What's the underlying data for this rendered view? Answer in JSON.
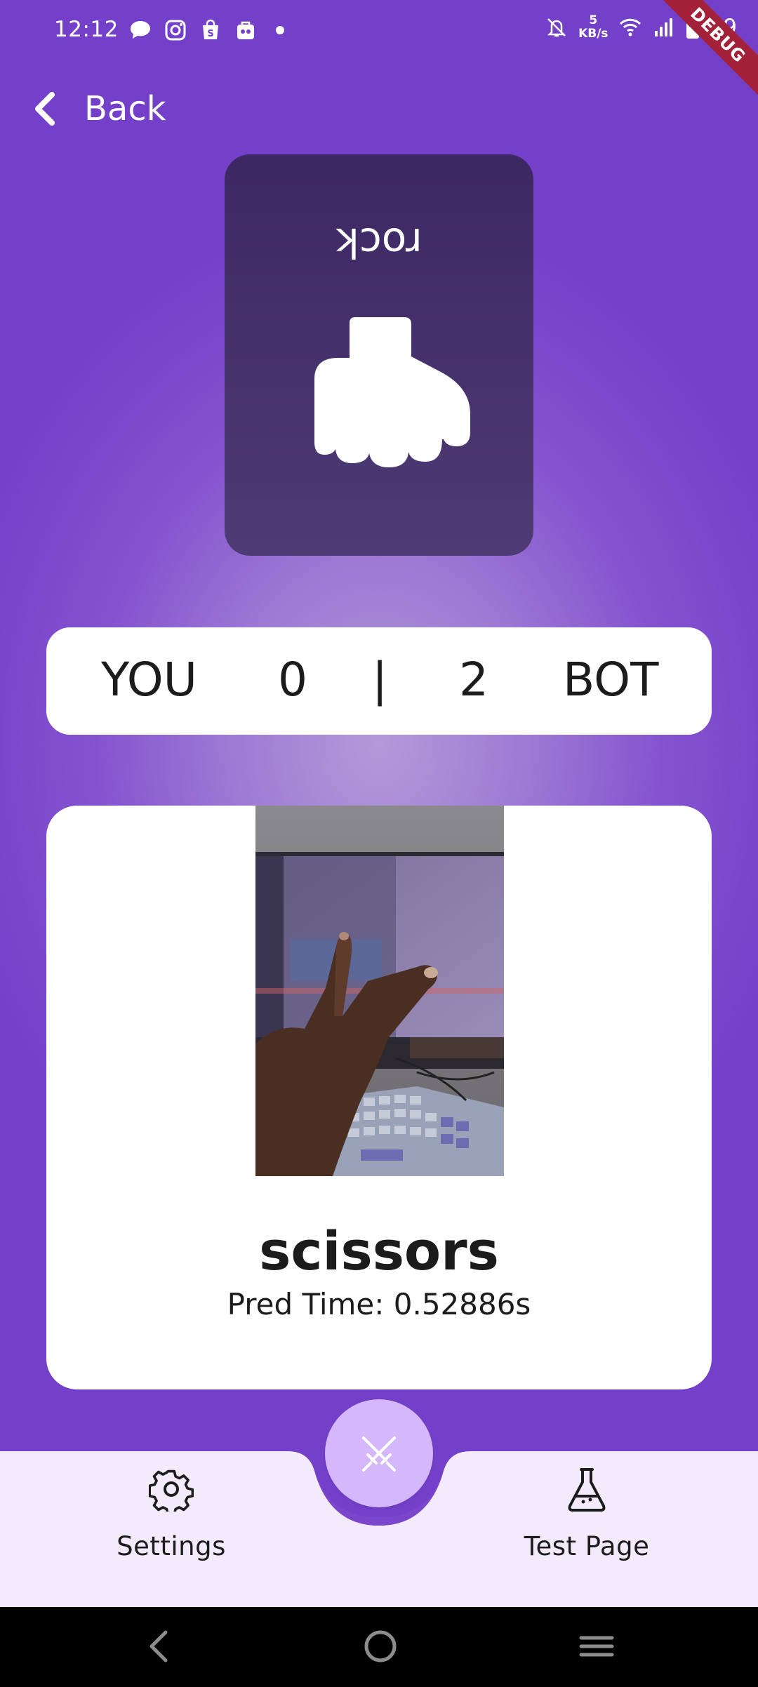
{
  "status_bar": {
    "time": "12:12",
    "net_speed_value": "5",
    "net_speed_unit": "KB/s",
    "battery": "69",
    "debug_banner": "DEBUG",
    "icons": [
      "chat-bubble-icon",
      "instagram-icon",
      "shop-icon",
      "game-bag-icon",
      "notification-dot",
      "mute-bell-icon",
      "wifi-icon",
      "signal-icon",
      "battery-icon"
    ]
  },
  "header": {
    "back_label": "Back"
  },
  "bot_card": {
    "label": "rock",
    "icon": "rock-hand-icon"
  },
  "scoreboard": {
    "player_label": "YOU",
    "player_score": "0",
    "separator": "|",
    "bot_score": "2",
    "bot_label": "BOT"
  },
  "prediction": {
    "label": "scissors",
    "pred_time": "Pred Time: 0.52886s"
  },
  "bottom_nav": {
    "settings_label": "Settings",
    "test_label": "Test Page",
    "fab_icon": "crossed-swords-icon"
  },
  "colors": {
    "background": "#8553cf",
    "card": "#ffffff",
    "bot_card": "#45306b",
    "fab": "#d4b8fb",
    "nav_bar": "#f3eafb",
    "debug_banner": "#a3223a"
  }
}
